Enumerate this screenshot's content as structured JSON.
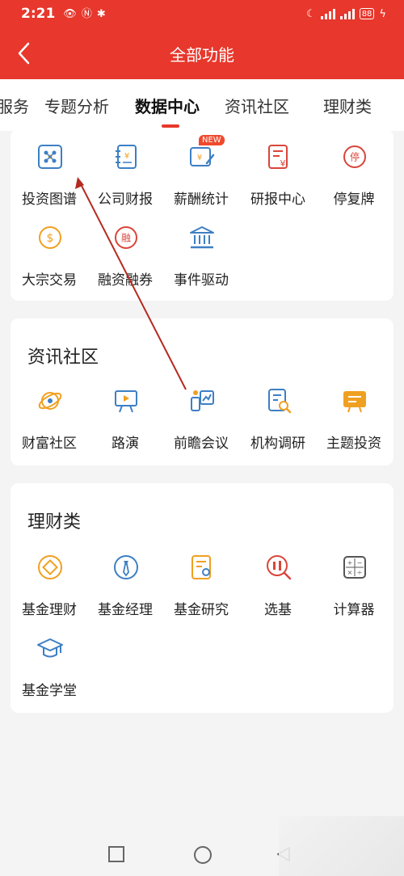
{
  "status_bar": {
    "time": "2:21",
    "battery": "88"
  },
  "header": {
    "title": "全部功能"
  },
  "tabs": [
    {
      "label": "服务"
    },
    {
      "label": "专题分析"
    },
    {
      "label": "数据中心"
    },
    {
      "label": "资讯社区"
    },
    {
      "label": "理财类"
    }
  ],
  "active_tab": "数据中心",
  "data_center": {
    "items": [
      {
        "label": "投资图谱",
        "icon": "network-graph-icon"
      },
      {
        "label": "公司财报",
        "icon": "financial-report-icon"
      },
      {
        "label": "薪酬统计",
        "icon": "salary-stats-icon",
        "badge": "NEW"
      },
      {
        "label": "研报中心",
        "icon": "research-report-icon"
      },
      {
        "label": "停复牌",
        "icon": "trading-halt-icon",
        "glyph": "停"
      },
      {
        "label": "大宗交易",
        "icon": "dollar-coin-icon",
        "glyph": "$"
      },
      {
        "label": "融资融券",
        "icon": "margin-trading-icon",
        "glyph": "融"
      },
      {
        "label": "事件驱动",
        "icon": "bank-building-icon"
      }
    ]
  },
  "news_community": {
    "title": "资讯社区",
    "items": [
      {
        "label": "财富社区",
        "icon": "planet-icon"
      },
      {
        "label": "路演",
        "icon": "presentation-board-icon"
      },
      {
        "label": "前瞻会议",
        "icon": "meeting-podium-icon"
      },
      {
        "label": "机构调研",
        "icon": "document-search-icon"
      },
      {
        "label": "主题投资",
        "icon": "theme-invest-icon"
      }
    ]
  },
  "wealth": {
    "title": "理财类",
    "items": [
      {
        "label": "基金理财",
        "icon": "fund-coin-icon"
      },
      {
        "label": "基金经理",
        "icon": "manager-tie-icon"
      },
      {
        "label": "基金研究",
        "icon": "fund-research-icon"
      },
      {
        "label": "选基",
        "icon": "fund-select-icon"
      },
      {
        "label": "计算器",
        "icon": "calculator-icon",
        "glyph": "+−×÷"
      },
      {
        "label": "基金学堂",
        "icon": "graduation-cap-icon"
      }
    ]
  },
  "colors": {
    "brand_red": "#e8372c",
    "icon_blue": "#3d7fc4",
    "icon_orange": "#f0a020",
    "icon_red": "#d9453a"
  }
}
